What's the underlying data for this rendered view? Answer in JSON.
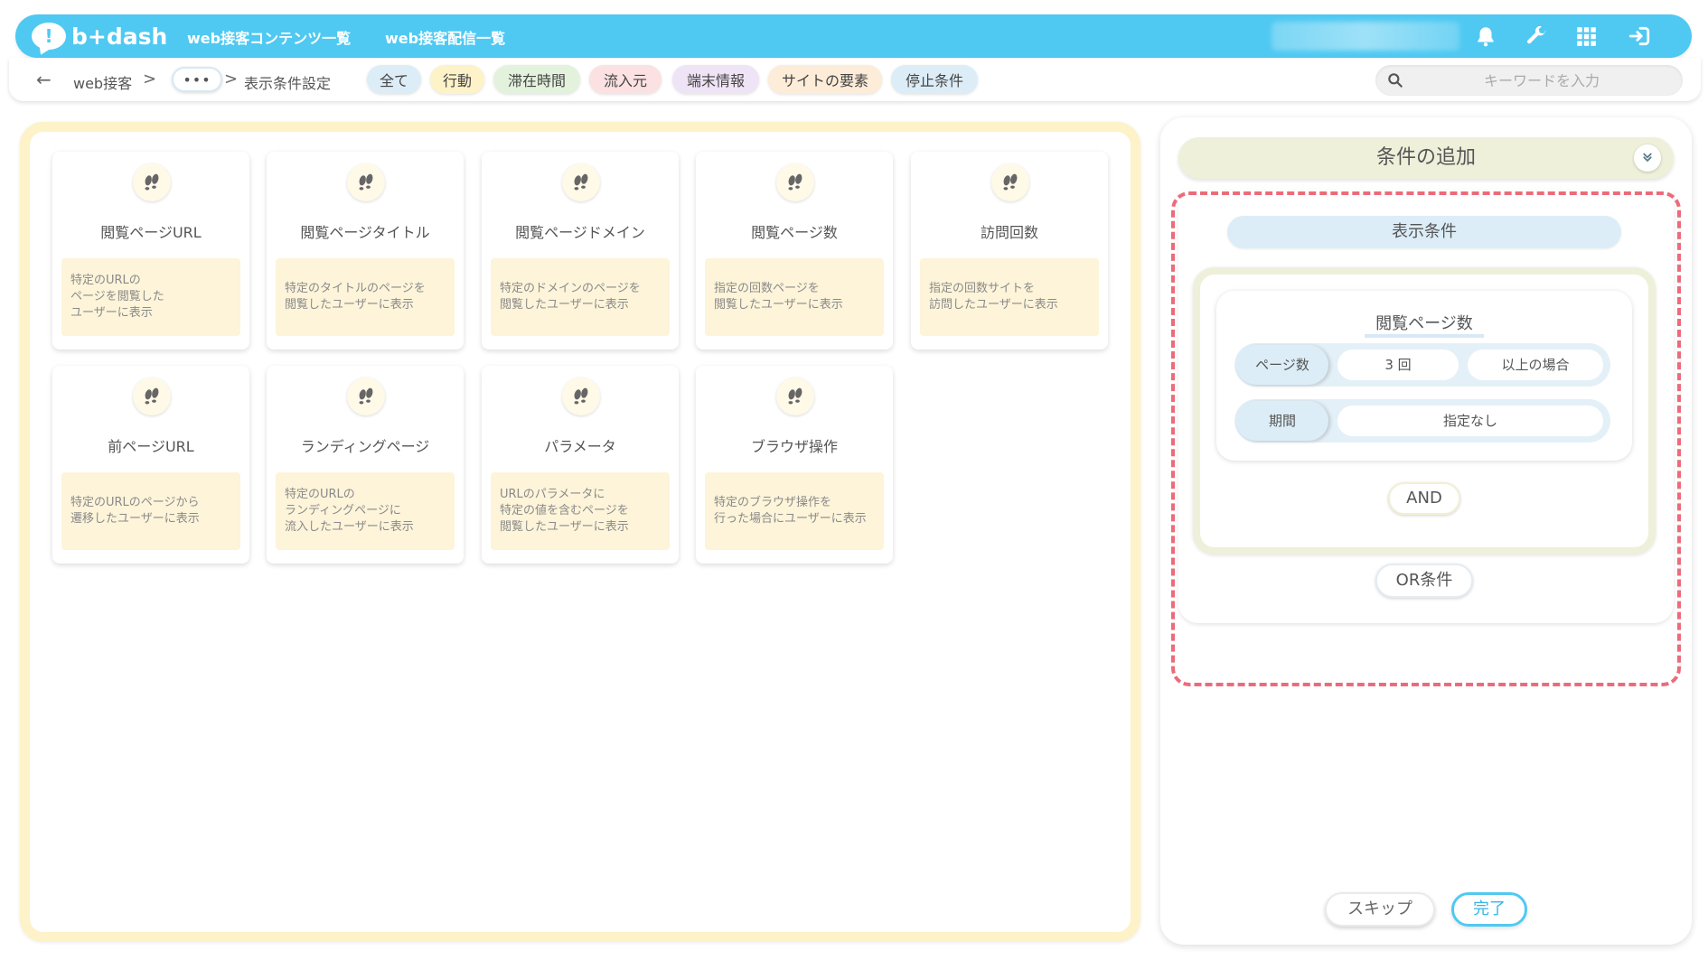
{
  "header": {
    "logo_text": "b+dash",
    "nav": [
      "web接客コンテンツ一覧",
      "web接客配信一覧"
    ]
  },
  "breadcrumb": {
    "back": "←",
    "root": "web接客",
    "sep": ">",
    "more": "•••",
    "current": "表示条件設定"
  },
  "filters": [
    {
      "label": "全て",
      "bg": "#dcedf7"
    },
    {
      "label": "行動",
      "bg": "#fdf2c8"
    },
    {
      "label": "滞在時間",
      "bg": "#e3f2dd"
    },
    {
      "label": "流入元",
      "bg": "#fbe1e1"
    },
    {
      "label": "端末情報",
      "bg": "#efe3f6"
    },
    {
      "label": "サイトの要素",
      "bg": "#fdecd8"
    },
    {
      "label": "停止条件",
      "bg": "#dcedf7"
    }
  ],
  "search": {
    "placeholder": "キーワードを入力"
  },
  "cards": [
    {
      "title": "閲覧ページURL",
      "desc": "特定のURLの\nページを閲覧した\nユーザーに表示"
    },
    {
      "title": "閲覧ページタイトル",
      "desc": "特定のタイトルのページを\n閲覧したユーザーに表示"
    },
    {
      "title": "閲覧ページドメイン",
      "desc": "特定のドメインのページを\n閲覧したユーザーに表示"
    },
    {
      "title": "閲覧ページ数",
      "desc": "指定の回数ページを\n閲覧したユーザーに表示"
    },
    {
      "title": "訪問回数",
      "desc": "指定の回数サイトを\n訪問したユーザーに表示"
    },
    {
      "title": "前ページURL",
      "desc": "特定のURLのページから\n遷移したユーザーに表示"
    },
    {
      "title": "ランディングページ",
      "desc": "特定のURLの\nランディングページに\n流入したユーザーに表示"
    },
    {
      "title": "パラメータ",
      "desc": "URLのパラメータに\n特定の値を含むページを\n閲覧したユーザーに表示"
    },
    {
      "title": "ブラウザ操作",
      "desc": "特定のブラウザ操作を\n行った場合にユーザーに表示"
    }
  ],
  "panel": {
    "title": "条件の追加",
    "display_condition": "表示条件",
    "condition": {
      "title": "閲覧ページ数",
      "row1": {
        "label": "ページ数",
        "count": "3 回",
        "mode": "以上の場合"
      },
      "row2": {
        "label": "期間",
        "value": "指定なし"
      }
    },
    "and_label": "AND",
    "or_label": "OR条件",
    "skip_label": "スキップ",
    "done_label": "完了"
  },
  "colors": {
    "accent": "#4fc9f2",
    "dashed": "#ec6b7a",
    "card_desc_bg": "#fdf4d9"
  }
}
